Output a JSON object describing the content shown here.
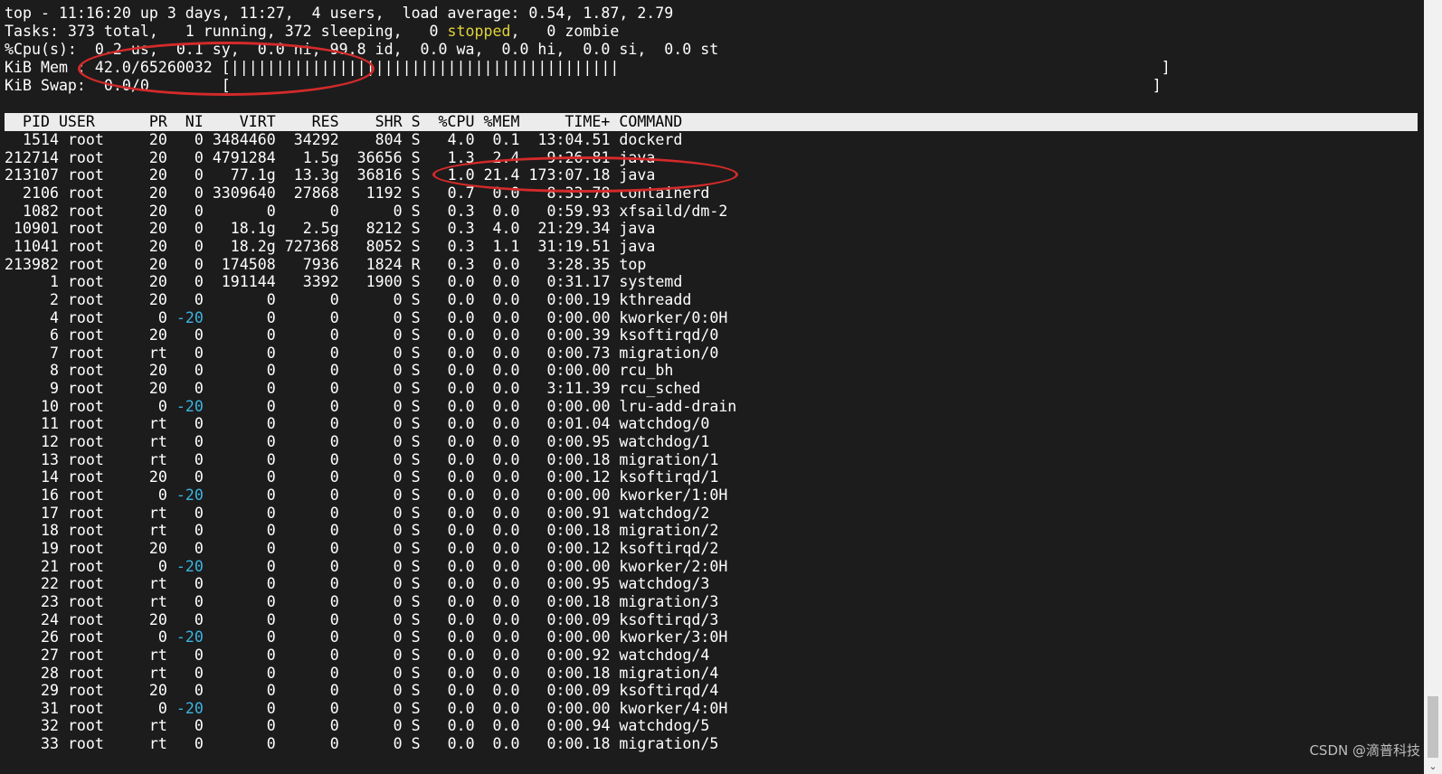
{
  "summary": {
    "uptime_line": "top - 11:16:20 up 3 days, 11:27,  4 users,  load average: 0.54, 1.87, 2.79",
    "tasks_pre": "Tasks: 373 total,   1 running, 372 sleeping,   0 ",
    "tasks_stopped": "stopped",
    "tasks_post": ",   0 zombie",
    "cpu_line": "%Cpu(s):  0.2 us,  0.1 sy,  0.0 ni, 99.8 id,  0.0 wa,  0.0 hi,  0.0 si,  0.0 st",
    "mem_line": "KiB Mem : 42.0/65260032 [|||||||||||||||||||||||||||||||||||||||||||                                                            ]",
    "swap_line": "KiB Swap:  0.0/0        [                                                                                                      ]"
  },
  "table": {
    "header": "  PID USER      PR  NI    VIRT    RES    SHR S  %CPU %MEM     TIME+ COMMAND",
    "rows": [
      {
        "pid": "1514",
        "user": "root",
        "pr": "20",
        "ni": "0",
        "virt": "3484460",
        "res": "34292",
        "shr": "804",
        "s": "S",
        "cpu": "4.0",
        "mem": "0.1",
        "time": "13:04.51",
        "cmd": "dockerd"
      },
      {
        "pid": "212714",
        "user": "root",
        "pr": "20",
        "ni": "0",
        "virt": "4791284",
        "res": "1.5g",
        "shr": "36656",
        "s": "S",
        "cpu": "1.3",
        "mem": "2.4",
        "time": "9:26.81",
        "cmd": "java"
      },
      {
        "pid": "213107",
        "user": "root",
        "pr": "20",
        "ni": "0",
        "virt": "77.1g",
        "res": "13.3g",
        "shr": "36816",
        "s": "S",
        "cpu": "1.0",
        "mem": "21.4",
        "time": "173:07.18",
        "cmd": "java"
      },
      {
        "pid": "2106",
        "user": "root",
        "pr": "20",
        "ni": "0",
        "virt": "3309640",
        "res": "27868",
        "shr": "1192",
        "s": "S",
        "cpu": "0.7",
        "mem": "0.0",
        "time": "8:33.78",
        "cmd": "containerd"
      },
      {
        "pid": "1082",
        "user": "root",
        "pr": "20",
        "ni": "0",
        "virt": "0",
        "res": "0",
        "shr": "0",
        "s": "S",
        "cpu": "0.3",
        "mem": "0.0",
        "time": "0:59.93",
        "cmd": "xfsaild/dm-2"
      },
      {
        "pid": "10901",
        "user": "root",
        "pr": "20",
        "ni": "0",
        "virt": "18.1g",
        "res": "2.5g",
        "shr": "8212",
        "s": "S",
        "cpu": "0.3",
        "mem": "4.0",
        "time": "21:29.34",
        "cmd": "java"
      },
      {
        "pid": "11041",
        "user": "root",
        "pr": "20",
        "ni": "0",
        "virt": "18.2g",
        "res": "727368",
        "shr": "8052",
        "s": "S",
        "cpu": "0.3",
        "mem": "1.1",
        "time": "31:19.51",
        "cmd": "java"
      },
      {
        "pid": "213982",
        "user": "root",
        "pr": "20",
        "ni": "0",
        "virt": "174508",
        "res": "7936",
        "shr": "1824",
        "s": "R",
        "cpu": "0.3",
        "mem": "0.0",
        "time": "3:28.35",
        "cmd": "top"
      },
      {
        "pid": "1",
        "user": "root",
        "pr": "20",
        "ni": "0",
        "virt": "191144",
        "res": "3392",
        "shr": "1900",
        "s": "S",
        "cpu": "0.0",
        "mem": "0.0",
        "time": "0:31.17",
        "cmd": "systemd"
      },
      {
        "pid": "2",
        "user": "root",
        "pr": "20",
        "ni": "0",
        "virt": "0",
        "res": "0",
        "shr": "0",
        "s": "S",
        "cpu": "0.0",
        "mem": "0.0",
        "time": "0:00.19",
        "cmd": "kthreadd"
      },
      {
        "pid": "4",
        "user": "root",
        "pr": "0",
        "ni": "-20",
        "virt": "0",
        "res": "0",
        "shr": "0",
        "s": "S",
        "cpu": "0.0",
        "mem": "0.0",
        "time": "0:00.00",
        "cmd": "kworker/0:0H"
      },
      {
        "pid": "6",
        "user": "root",
        "pr": "20",
        "ni": "0",
        "virt": "0",
        "res": "0",
        "shr": "0",
        "s": "S",
        "cpu": "0.0",
        "mem": "0.0",
        "time": "0:00.39",
        "cmd": "ksoftirqd/0"
      },
      {
        "pid": "7",
        "user": "root",
        "pr": "rt",
        "ni": "0",
        "virt": "0",
        "res": "0",
        "shr": "0",
        "s": "S",
        "cpu": "0.0",
        "mem": "0.0",
        "time": "0:00.73",
        "cmd": "migration/0"
      },
      {
        "pid": "8",
        "user": "root",
        "pr": "20",
        "ni": "0",
        "virt": "0",
        "res": "0",
        "shr": "0",
        "s": "S",
        "cpu": "0.0",
        "mem": "0.0",
        "time": "0:00.00",
        "cmd": "rcu_bh"
      },
      {
        "pid": "9",
        "user": "root",
        "pr": "20",
        "ni": "0",
        "virt": "0",
        "res": "0",
        "shr": "0",
        "s": "S",
        "cpu": "0.0",
        "mem": "0.0",
        "time": "3:11.39",
        "cmd": "rcu_sched"
      },
      {
        "pid": "10",
        "user": "root",
        "pr": "0",
        "ni": "-20",
        "virt": "0",
        "res": "0",
        "shr": "0",
        "s": "S",
        "cpu": "0.0",
        "mem": "0.0",
        "time": "0:00.00",
        "cmd": "lru-add-drain"
      },
      {
        "pid": "11",
        "user": "root",
        "pr": "rt",
        "ni": "0",
        "virt": "0",
        "res": "0",
        "shr": "0",
        "s": "S",
        "cpu": "0.0",
        "mem": "0.0",
        "time": "0:01.04",
        "cmd": "watchdog/0"
      },
      {
        "pid": "12",
        "user": "root",
        "pr": "rt",
        "ni": "0",
        "virt": "0",
        "res": "0",
        "shr": "0",
        "s": "S",
        "cpu": "0.0",
        "mem": "0.0",
        "time": "0:00.95",
        "cmd": "watchdog/1"
      },
      {
        "pid": "13",
        "user": "root",
        "pr": "rt",
        "ni": "0",
        "virt": "0",
        "res": "0",
        "shr": "0",
        "s": "S",
        "cpu": "0.0",
        "mem": "0.0",
        "time": "0:00.18",
        "cmd": "migration/1"
      },
      {
        "pid": "14",
        "user": "root",
        "pr": "20",
        "ni": "0",
        "virt": "0",
        "res": "0",
        "shr": "0",
        "s": "S",
        "cpu": "0.0",
        "mem": "0.0",
        "time": "0:00.12",
        "cmd": "ksoftirqd/1"
      },
      {
        "pid": "16",
        "user": "root",
        "pr": "0",
        "ni": "-20",
        "virt": "0",
        "res": "0",
        "shr": "0",
        "s": "S",
        "cpu": "0.0",
        "mem": "0.0",
        "time": "0:00.00",
        "cmd": "kworker/1:0H"
      },
      {
        "pid": "17",
        "user": "root",
        "pr": "rt",
        "ni": "0",
        "virt": "0",
        "res": "0",
        "shr": "0",
        "s": "S",
        "cpu": "0.0",
        "mem": "0.0",
        "time": "0:00.91",
        "cmd": "watchdog/2"
      },
      {
        "pid": "18",
        "user": "root",
        "pr": "rt",
        "ni": "0",
        "virt": "0",
        "res": "0",
        "shr": "0",
        "s": "S",
        "cpu": "0.0",
        "mem": "0.0",
        "time": "0:00.18",
        "cmd": "migration/2"
      },
      {
        "pid": "19",
        "user": "root",
        "pr": "20",
        "ni": "0",
        "virt": "0",
        "res": "0",
        "shr": "0",
        "s": "S",
        "cpu": "0.0",
        "mem": "0.0",
        "time": "0:00.12",
        "cmd": "ksoftirqd/2"
      },
      {
        "pid": "21",
        "user": "root",
        "pr": "0",
        "ni": "-20",
        "virt": "0",
        "res": "0",
        "shr": "0",
        "s": "S",
        "cpu": "0.0",
        "mem": "0.0",
        "time": "0:00.00",
        "cmd": "kworker/2:0H"
      },
      {
        "pid": "22",
        "user": "root",
        "pr": "rt",
        "ni": "0",
        "virt": "0",
        "res": "0",
        "shr": "0",
        "s": "S",
        "cpu": "0.0",
        "mem": "0.0",
        "time": "0:00.95",
        "cmd": "watchdog/3"
      },
      {
        "pid": "23",
        "user": "root",
        "pr": "rt",
        "ni": "0",
        "virt": "0",
        "res": "0",
        "shr": "0",
        "s": "S",
        "cpu": "0.0",
        "mem": "0.0",
        "time": "0:00.18",
        "cmd": "migration/3"
      },
      {
        "pid": "24",
        "user": "root",
        "pr": "20",
        "ni": "0",
        "virt": "0",
        "res": "0",
        "shr": "0",
        "s": "S",
        "cpu": "0.0",
        "mem": "0.0",
        "time": "0:00.09",
        "cmd": "ksoftirqd/3"
      },
      {
        "pid": "26",
        "user": "root",
        "pr": "0",
        "ni": "-20",
        "virt": "0",
        "res": "0",
        "shr": "0",
        "s": "S",
        "cpu": "0.0",
        "mem": "0.0",
        "time": "0:00.00",
        "cmd": "kworker/3:0H"
      },
      {
        "pid": "27",
        "user": "root",
        "pr": "rt",
        "ni": "0",
        "virt": "0",
        "res": "0",
        "shr": "0",
        "s": "S",
        "cpu": "0.0",
        "mem": "0.0",
        "time": "0:00.92",
        "cmd": "watchdog/4"
      },
      {
        "pid": "28",
        "user": "root",
        "pr": "rt",
        "ni": "0",
        "virt": "0",
        "res": "0",
        "shr": "0",
        "s": "S",
        "cpu": "0.0",
        "mem": "0.0",
        "time": "0:00.18",
        "cmd": "migration/4"
      },
      {
        "pid": "29",
        "user": "root",
        "pr": "20",
        "ni": "0",
        "virt": "0",
        "res": "0",
        "shr": "0",
        "s": "S",
        "cpu": "0.0",
        "mem": "0.0",
        "time": "0:00.09",
        "cmd": "ksoftirqd/4"
      },
      {
        "pid": "31",
        "user": "root",
        "pr": "0",
        "ni": "-20",
        "virt": "0",
        "res": "0",
        "shr": "0",
        "s": "S",
        "cpu": "0.0",
        "mem": "0.0",
        "time": "0:00.00",
        "cmd": "kworker/4:0H"
      },
      {
        "pid": "32",
        "user": "root",
        "pr": "rt",
        "ni": "0",
        "virt": "0",
        "res": "0",
        "shr": "0",
        "s": "S",
        "cpu": "0.0",
        "mem": "0.0",
        "time": "0:00.94",
        "cmd": "watchdog/5"
      },
      {
        "pid": "33",
        "user": "root",
        "pr": "rt",
        "ni": "0",
        "virt": "0",
        "res": "0",
        "shr": "0",
        "s": "S",
        "cpu": "0.0",
        "mem": "0.0",
        "time": "0:00.18",
        "cmd": "migration/5"
      }
    ]
  },
  "watermark": "CSDN @滴普科技",
  "scrollbar": {
    "down_icon": "chevron-down-icon"
  },
  "colors": {
    "background": "#1c1c1c",
    "foreground": "#ffffff",
    "header_bar": "#ececec",
    "stopped": "#e0d23a",
    "negative_nice": "#3cb4e0",
    "annotation": "#d42a2a"
  }
}
